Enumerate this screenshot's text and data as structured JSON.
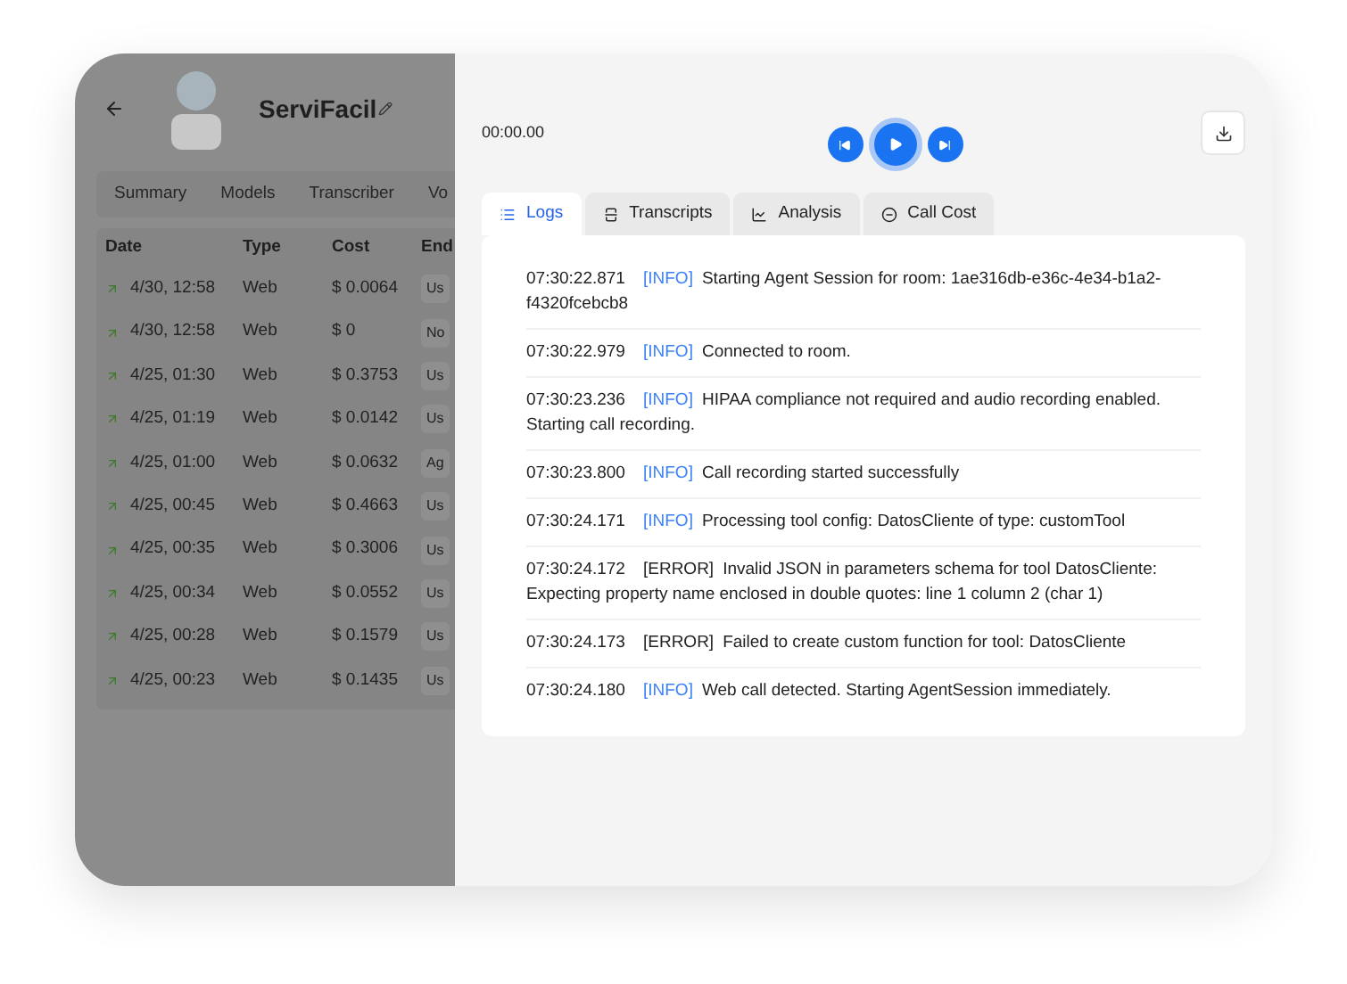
{
  "agent": {
    "name": "ServiFacil"
  },
  "tabs": [
    {
      "label": "Summary",
      "selected": false
    },
    {
      "label": "Models",
      "selected": false
    },
    {
      "label": "Transcriber",
      "selected": false
    },
    {
      "label": "Vo",
      "selected": false
    }
  ],
  "calls_table": {
    "columns": [
      "Date",
      "Type",
      "Cost",
      "End"
    ],
    "rows": [
      {
        "date": "4/30, 12:58",
        "type": "Web",
        "cost": "$ 0.0064",
        "end": "Us"
      },
      {
        "date": "4/30, 12:58",
        "type": "Web",
        "cost": "$ 0",
        "end": "No"
      },
      {
        "date": "4/25, 01:30",
        "type": "Web",
        "cost": "$ 0.3753",
        "end": "Us"
      },
      {
        "date": "4/25, 01:19",
        "type": "Web",
        "cost": "$ 0.0142",
        "end": "Us"
      },
      {
        "date": "4/25, 01:00",
        "type": "Web",
        "cost": "$ 0.0632",
        "end": "Ag"
      },
      {
        "date": "4/25, 00:45",
        "type": "Web",
        "cost": "$ 0.4663",
        "end": "Us"
      },
      {
        "date": "4/25, 00:35",
        "type": "Web",
        "cost": "$ 0.3006",
        "end": "Us"
      },
      {
        "date": "4/25, 00:34",
        "type": "Web",
        "cost": "$ 0.0552",
        "end": "Us"
      },
      {
        "date": "4/25, 00:28",
        "type": "Web",
        "cost": "$ 0.1579",
        "end": "Us"
      },
      {
        "date": "4/25, 00:23",
        "type": "Web",
        "cost": "$ 0.1435",
        "end": "Us"
      }
    ]
  },
  "player": {
    "time": "00:00.00"
  },
  "detail_tabs": [
    {
      "label": "Logs",
      "kind": "logs",
      "selected": true
    },
    {
      "label": "Transcripts",
      "kind": "transcripts",
      "selected": false
    },
    {
      "label": "Analysis",
      "kind": "analysis",
      "selected": false
    },
    {
      "label": "Call Cost",
      "kind": "cost",
      "selected": false
    }
  ],
  "logs": [
    {
      "time": "07:30:22.871",
      "kind": "info",
      "tag": "[INFO]",
      "message": "Starting Agent Session for room: 1ae316db-e36c-4e34-b1a2-f4320fcebcb8"
    },
    {
      "time": "07:30:22.979",
      "kind": "info",
      "tag": "[INFO]",
      "message": "Connected to room."
    },
    {
      "time": "07:30:23.236",
      "kind": "info",
      "tag": "[INFO]",
      "message": "HIPAA compliance not required and audio recording enabled. Starting call recording."
    },
    {
      "time": "07:30:23.800",
      "kind": "info",
      "tag": "[INFO]",
      "message": "Call recording started successfully"
    },
    {
      "time": "07:30:24.171",
      "kind": "info",
      "tag": "[INFO]",
      "message": "Processing tool config: DatosCliente of type: customTool"
    },
    {
      "time": "07:30:24.172",
      "kind": "error",
      "tag": "[ERROR]",
      "message": "Invalid JSON in parameters schema for tool DatosCliente: Expecting property name enclosed in double quotes: line 1 column 2 (char 1)"
    },
    {
      "time": "07:30:24.173",
      "kind": "error",
      "tag": "[ERROR]",
      "message": "Failed to create custom function for tool: DatosCliente"
    },
    {
      "time": "07:30:24.180",
      "kind": "info",
      "tag": "[INFO]",
      "message": "Web call detected. Starting AgentSession immediately."
    }
  ]
}
